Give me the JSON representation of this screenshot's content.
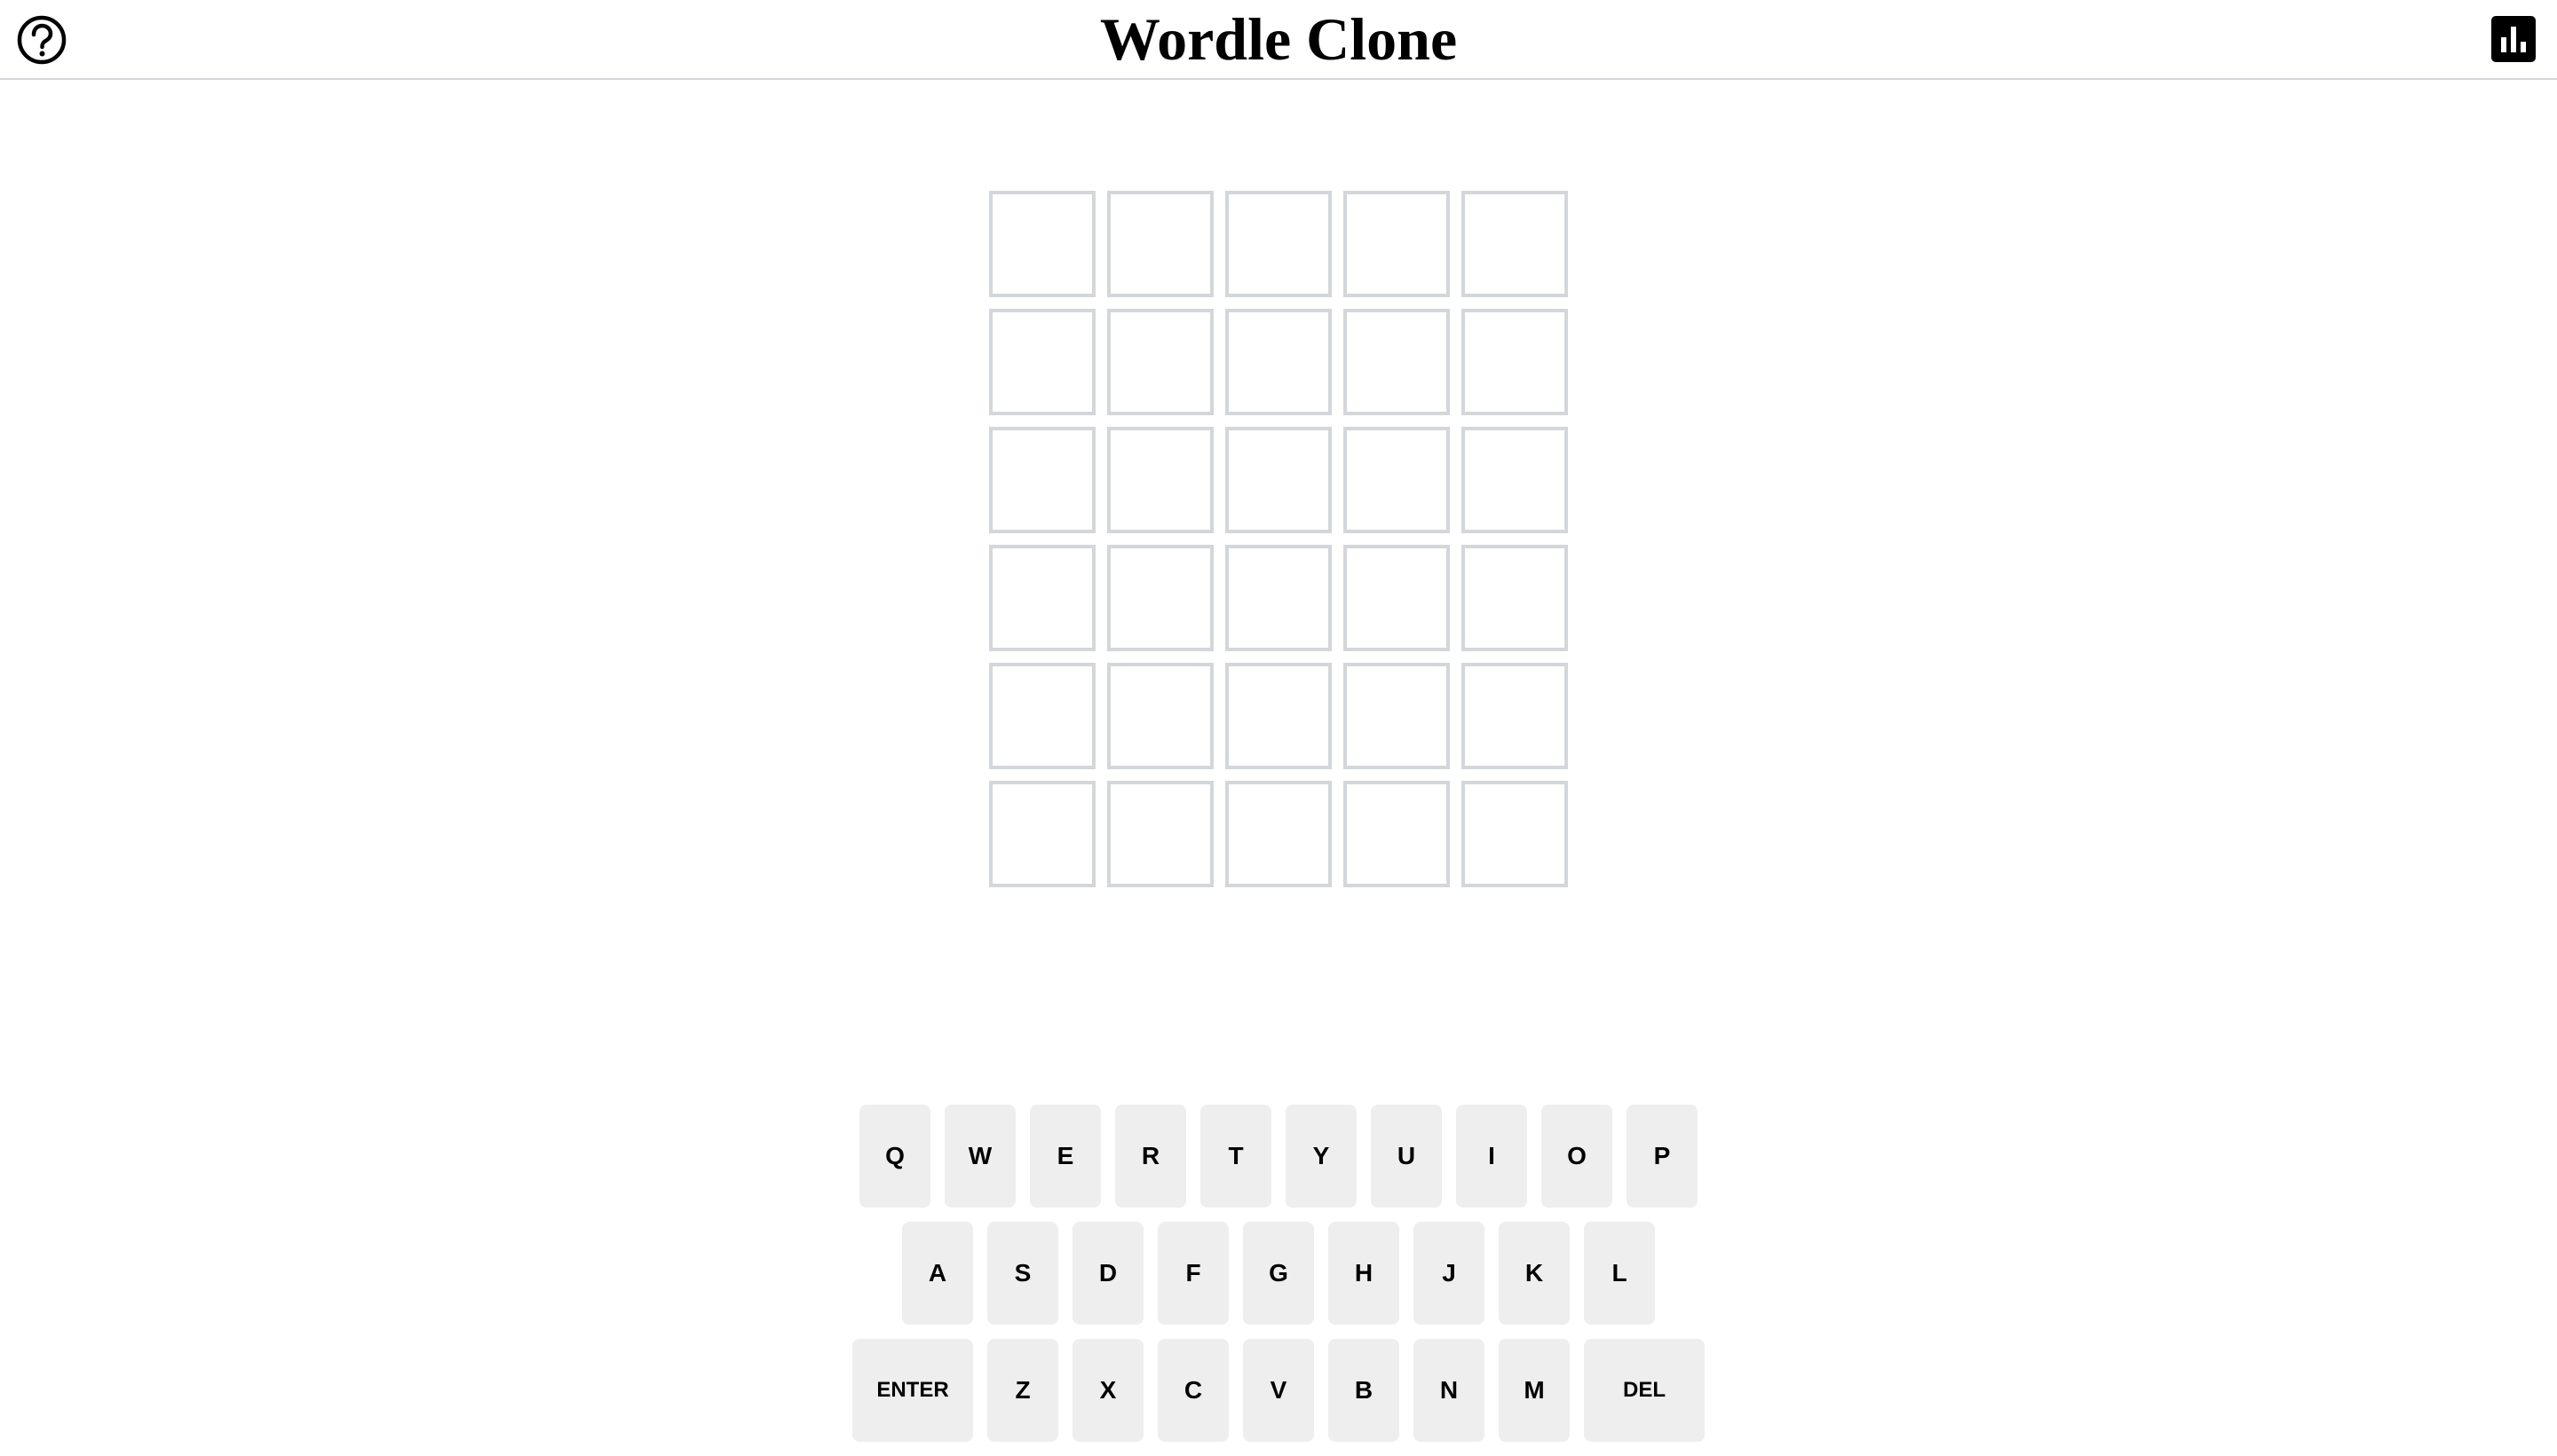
{
  "header": {
    "title": "Wordle Clone",
    "help_icon": "question-circle-icon",
    "stats_icon": "bar-chart-icon"
  },
  "board": {
    "rows": 6,
    "cols": 5,
    "tiles": [
      [
        "",
        "",
        "",
        "",
        ""
      ],
      [
        "",
        "",
        "",
        "",
        ""
      ],
      [
        "",
        "",
        "",
        "",
        ""
      ],
      [
        "",
        "",
        "",
        "",
        ""
      ],
      [
        "",
        "",
        "",
        "",
        ""
      ],
      [
        "",
        "",
        "",
        "",
        ""
      ]
    ]
  },
  "keyboard": {
    "rows": [
      [
        "Q",
        "W",
        "E",
        "R",
        "T",
        "Y",
        "U",
        "I",
        "O",
        "P"
      ],
      [
        "A",
        "S",
        "D",
        "F",
        "G",
        "H",
        "J",
        "K",
        "L"
      ],
      [
        "ENTER",
        "Z",
        "X",
        "C",
        "V",
        "B",
        "N",
        "M",
        "DEL"
      ]
    ]
  },
  "colors": {
    "tile_border": "#d3d6da",
    "key_background": "#eeeeee",
    "text": "#000000"
  }
}
